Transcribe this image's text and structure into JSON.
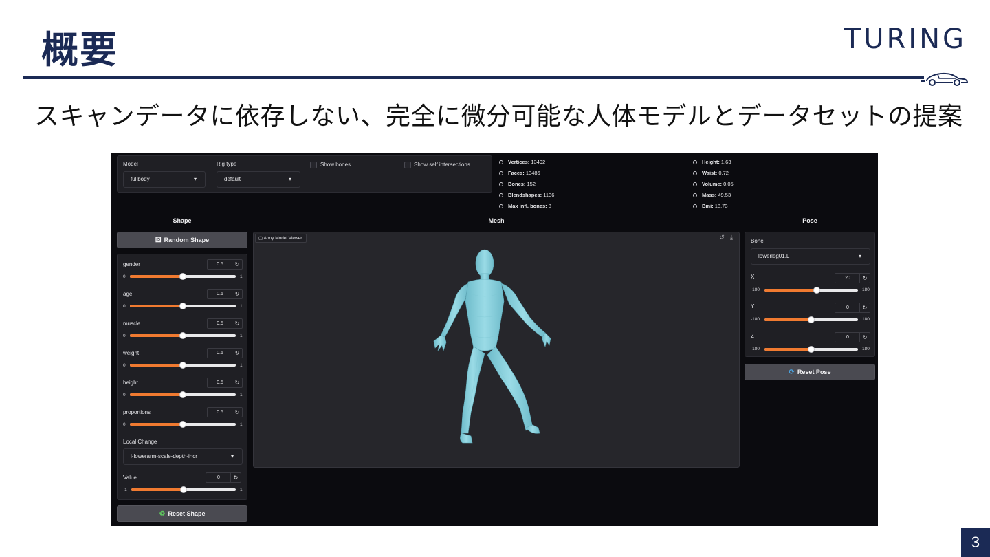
{
  "slide": {
    "title": "概要",
    "brand": "TURING",
    "subtitle": "スキャンデータに依存しない、完全に微分可能な人体モデルとデータセットの提案",
    "page_number": "3",
    "accent_color": "#1b2a55"
  },
  "app": {
    "model": {
      "label": "Model",
      "value": "fullbody"
    },
    "rig_type": {
      "label": "Rig type",
      "value": "default"
    },
    "show_bones_label": "Show bones",
    "show_self_intersections_label": "Show self intersections",
    "stats_left": [
      {
        "key": "Vertices:",
        "value": " 13492"
      },
      {
        "key": "Faces:",
        "value": " 13486"
      },
      {
        "key": "Bones:",
        "value": " 152"
      },
      {
        "key": "Blendshapes:",
        "value": " 1136"
      },
      {
        "key": "Max infl. bones:",
        "value": " 8"
      }
    ],
    "stats_right": [
      {
        "key": "Height:",
        "value": " 1.63"
      },
      {
        "key": "Waist:",
        "value": " 0.72"
      },
      {
        "key": "Volume:",
        "value": " 0.05"
      },
      {
        "key": "Mass:",
        "value": " 49.53"
      },
      {
        "key": "Bmi:",
        "value": " 18.73"
      }
    ],
    "sections": {
      "shape": "Shape",
      "mesh": "Mesh",
      "pose": "Pose"
    },
    "random_shape_label": "Random Shape",
    "reset_shape_label": "Reset Shape",
    "reset_pose_label": "Reset Pose",
    "shape_params": [
      {
        "name": "gender",
        "value": "0.5",
        "min": "0",
        "max": "1",
        "fraction": 0.5
      },
      {
        "name": "age",
        "value": "0.5",
        "min": "0",
        "max": "1",
        "fraction": 0.5
      },
      {
        "name": "muscle",
        "value": "0.5",
        "min": "0",
        "max": "1",
        "fraction": 0.5
      },
      {
        "name": "weight",
        "value": "0.5",
        "min": "0",
        "max": "1",
        "fraction": 0.5
      },
      {
        "name": "height",
        "value": "0.5",
        "min": "0",
        "max": "1",
        "fraction": 0.5
      },
      {
        "name": "proportions",
        "value": "0.5",
        "min": "0",
        "max": "1",
        "fraction": 0.5
      }
    ],
    "local_change": {
      "label": "Local Change",
      "value": "l-lowerarm-scale-depth-incr"
    },
    "local_value": {
      "name": "Value",
      "value": "0",
      "min": "-1",
      "max": "1",
      "fraction": 0.5
    },
    "viewer_label": "Anny Model Viewer",
    "bone": {
      "label": "Bone",
      "value": "lowerleg01.L"
    },
    "pose_params": [
      {
        "name": "X",
        "value": "20",
        "min": "-180",
        "max": "180",
        "fraction": 0.556
      },
      {
        "name": "Y",
        "value": "0",
        "min": "-180",
        "max": "180",
        "fraction": 0.5
      },
      {
        "name": "Z",
        "value": "0",
        "min": "-180",
        "max": "180",
        "fraction": 0.5
      }
    ],
    "icons": {
      "random": "dice-icon",
      "reset_shape": "recycle-icon",
      "reset_pose": "refresh-icon",
      "viewer_reset": "undo-icon",
      "viewer_download": "download-icon"
    },
    "colors": {
      "slider_fill": "#f07a30",
      "mesh": "#8fd3df",
      "background": "#0b0b0f"
    }
  }
}
